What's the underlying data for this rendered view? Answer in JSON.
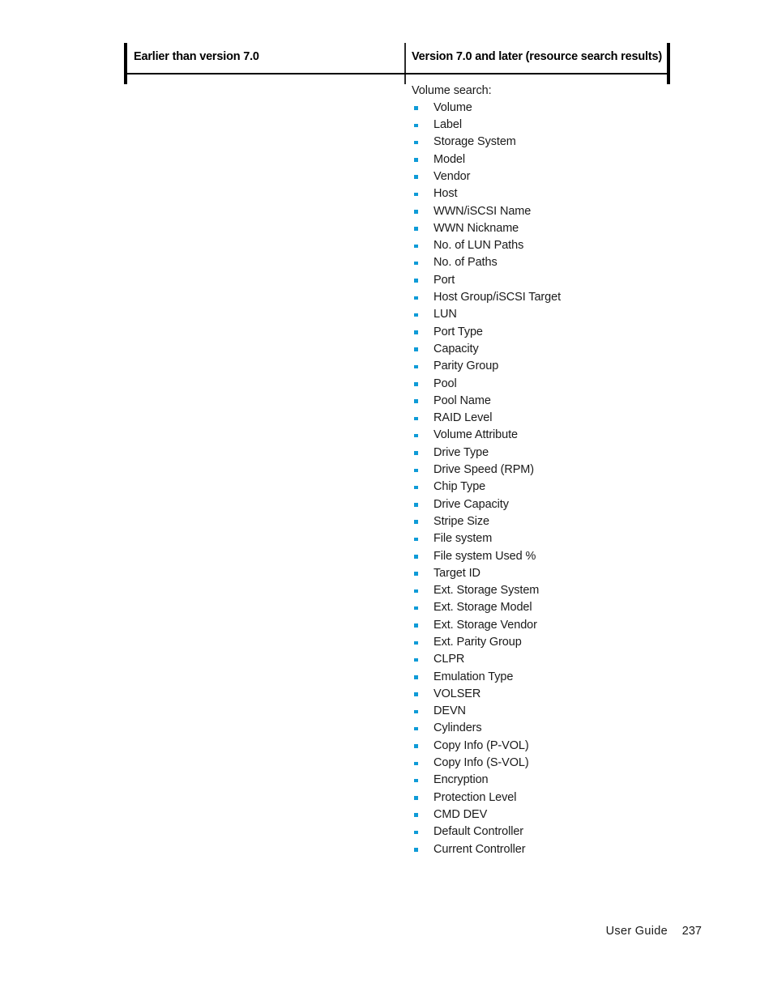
{
  "table": {
    "columns": [
      {
        "header": "Earlier than version 7.0"
      },
      {
        "header": "Version 7.0 and later (resource search results)"
      }
    ],
    "left_cell": {
      "text": ""
    },
    "right_cell": {
      "intro": "Volume search:",
      "items": [
        "Volume",
        "Label",
        "Storage System",
        "Model",
        "Vendor",
        "Host",
        "WWN/iSCSI Name",
        "WWN Nickname",
        "No. of LUN Paths",
        "No. of Paths",
        "Port",
        "Host Group/iSCSI Target",
        "LUN",
        "Port Type",
        "Capacity",
        "Parity Group",
        "Pool",
        "Pool Name",
        "RAID Level",
        "Volume Attribute",
        "Drive Type",
        "Drive Speed (RPM)",
        "Chip Type",
        "Drive Capacity",
        "Stripe Size",
        "File system",
        "File system Used %",
        "Target ID",
        "Ext. Storage System",
        "Ext. Storage Model",
        "Ext. Storage Vendor",
        "Ext. Parity Group",
        "CLPR",
        "Emulation Type",
        "VOLSER",
        "DEVN",
        "Cylinders",
        "Copy Info (P-VOL)",
        "Copy Info (S-VOL)",
        "Encryption",
        "Protection Level",
        "CMD DEV",
        "Default Controller",
        "Current Controller"
      ]
    }
  },
  "footer": {
    "label": "User Guide",
    "page_number": "237"
  },
  "colors": {
    "bullet": "#0f9bd7",
    "rule": "#000000",
    "text": "#1a1a1a"
  }
}
